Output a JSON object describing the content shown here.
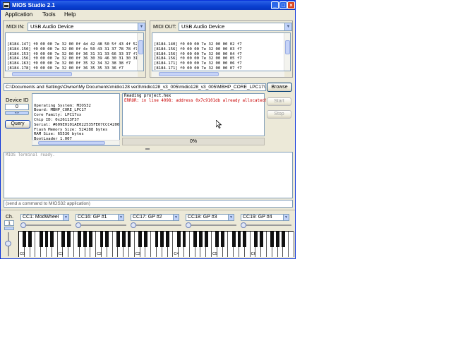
{
  "window": {
    "title": "MIOS Studio 2.1"
  },
  "menu": [
    "Application",
    "Tools",
    "Help"
  ],
  "midi_in": {
    "label": "MIDI IN:",
    "device": "USB Audio Device",
    "log": [
      "[8184.147] f0 00 00 7e 32 00 0f 4d 42 48 50 5f 43 4f 52 45 5",
      "[8184.150] f0 00 00 7e 32 00 0f 4c 50 43 31 37 78 78 f7",
      "[8184.153] f0 00 00 7e 32 00 0f 36 31 31 33 66 33 37 f7",
      "[8184.156] f0 00 00 7e 32 00 0f 36 30 39 46 30 31 30 31 41 4",
      "[8184.163] f0 00 00 7e 32 00 0f 35 32 34 32 38 38 f7",
      "[8184.178] f0 00 00 7e 32 00 0f 36 35 35 33 36 f7",
      "[8184.181] f0 00 00 7e 32 00 0f 42 6f 6f 74 6c 6f 61 64 65 7",
      "[8184.184] f0 00 00 7e 32 00 0f 28 43 29 20 32 30 30 39 20 5"
    ]
  },
  "midi_out": {
    "label": "MIDI OUT:",
    "device": "USB Audio Device",
    "log": [
      "[8184.140] f0 00 00 7e 32 00 00 02 f7",
      "[8184.156] f0 00 00 7e 32 00 00 03 f7",
      "[8184.156] f0 00 00 7e 32 00 00 04 f7",
      "[8184.156] f0 00 00 7e 32 00 00 05 f7",
      "[8184.171] f0 00 00 7e 32 00 00 06 f7",
      "[8184.171] f0 00 00 7e 32 00 00 07 f7",
      "[8184.187] f0 00 00 7e 32 00 00 08 f7",
      "[8184.187] f0 00 00 7e 32 00 00 09 f7"
    ]
  },
  "upload": {
    "path": "C:\\Documents and Settings\\Owner\\My Documents\\midio128 ver3\\midio128_v3_005\\midio128_v3_005\\MBHP_CORE_LPC17\\project.hex",
    "browse_label": "Browse",
    "start_label": "Start",
    "stop_label": "Stop",
    "log_line1": "Reading project.hex",
    "log_error": "ERROR: in line 4098: address 0x7c9101db already allocated!",
    "progress": "0%",
    "progress_value": 0
  },
  "device": {
    "label": "Device ID",
    "id": "0",
    "query_label": "Query"
  },
  "info": [
    "Operating System: MIOS32",
    "Board: MBHP_CORE_LPC17",
    "Core Family: LPC17xx",
    "Chip ID: 0x26113F37",
    "Serial: #609E0101AE022535FE07CCC4200000",
    "Flash Memory Size: 524288 bytes",
    "RAM Size: 65536 bytes",
    "BootLoader 1.007",
    "(C) 2009 T.Klose"
  ],
  "terminal": {
    "text": "MIOS Terminal ready.",
    "placeholder": "(send a command to MIOS32 application)"
  },
  "keyboard_panel": {
    "channel_label": "Ch.",
    "channel_value": "1",
    "cc": [
      "CC1: ModWheel",
      "CC16: GP #1",
      "CC17: GP #2",
      "CC18: GP #3",
      "CC19: GP #4"
    ],
    "octave_labels": [
      "C0",
      "C1",
      "C2",
      "C3",
      "C4",
      "C5",
      "C6"
    ]
  },
  "colors": {
    "titlebar": "#0a3fd0",
    "error": "#c80000",
    "window_bg": "#ece9d8"
  }
}
